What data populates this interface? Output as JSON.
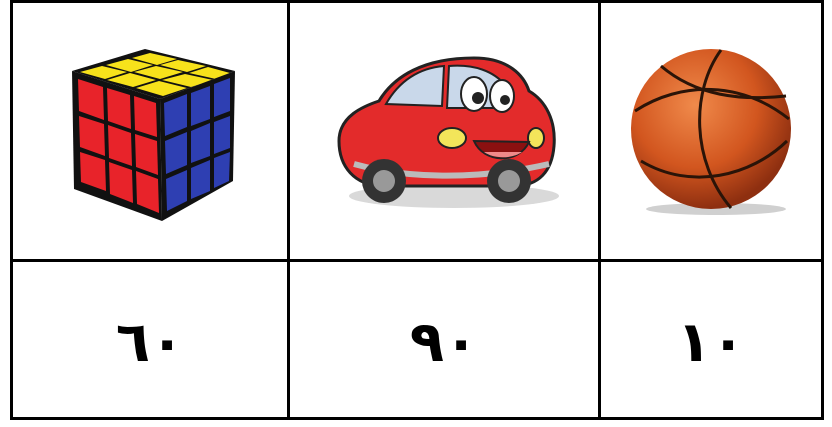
{
  "cards": [
    {
      "image": "rubiks-cube-icon",
      "number": "٦٠"
    },
    {
      "image": "red-cartoon-car-icon",
      "number": "٩٠"
    },
    {
      "image": "basketball-icon",
      "number": "١٠"
    }
  ],
  "colors": {
    "border": "#000000",
    "cube_red": "#e8232a",
    "cube_yellow": "#f7e21b",
    "cube_blue": "#2e3fb2",
    "car_red": "#e32b2b",
    "ball_orange": "#d2561f"
  }
}
